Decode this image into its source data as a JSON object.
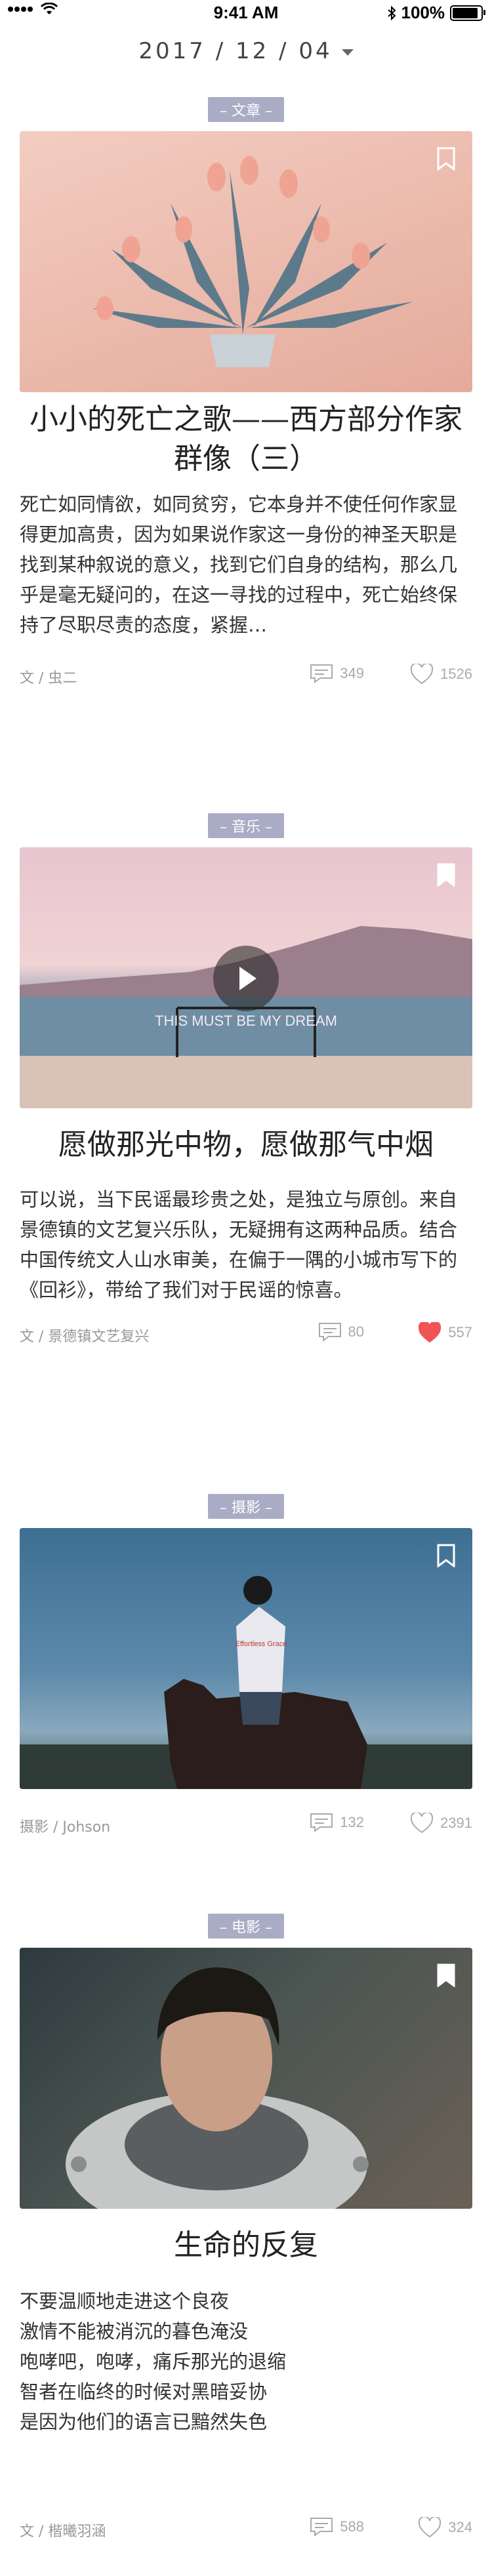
{
  "status_bar": {
    "time": "9:41 AM",
    "battery": "100%",
    "battery_level": 1.0
  },
  "date": {
    "label": "2017 / 12 / 04"
  },
  "cards": [
    {
      "tag": "– 文章 –",
      "title": "小小的死亡之歌——西方部分作家群像（三）",
      "body": "死亡如同情欲，如同贫穷，它本身并不使任何作家显得更加高贵，因为如果说作家这一身份的神圣天职是找到某种叙说的意义，找到它们自身的结构，那么几乎是毫无疑问的，在这一寻找的过程中，死亡始终保持了尽职尽责的态度，紧握…",
      "author": "文 / 虫二",
      "comments": "349",
      "likes": "1526",
      "liked": false
    },
    {
      "tag": "– 音乐 –",
      "title": "愿做那光中物，愿做那气中烟",
      "body": "可以说，当下民谣最珍贵之处，是独立与原创。来自景德镇的文艺复兴乐队，无疑拥有这两种品质。结合中国传统文人山水审美，在偏于一隅的小城市写下的《回衫》，带给了我们对于民谣的惊喜。",
      "author": "文 / 景德镇文艺复兴",
      "comments": "80",
      "likes": "557",
      "liked": true,
      "sign_text": "THIS MUST BE MY DREAM"
    },
    {
      "tag": "– 摄影 –",
      "author": "摄影 / Johson",
      "comments": "132",
      "likes": "2391",
      "liked": false,
      "shirt_text": "Effortless Grace"
    },
    {
      "tag": "– 电影 –",
      "title": "生命的反复",
      "lines": [
        "不要温顺地走进这个良夜",
        "激情不能被消沉的暮色淹没",
        "咆哮吧，咆哮，痛斥那光的退缩",
        "智者在临终的时候对黑暗妥协",
        "是因为他们的语言已黯然失色"
      ],
      "author": "文 / 楷曦羽涵",
      "comments": "588",
      "likes": "324",
      "liked": false
    }
  ],
  "colors": {
    "tag_bg": "#a9acc4",
    "like_red": "#f05454",
    "meta_gray": "#999999"
  }
}
